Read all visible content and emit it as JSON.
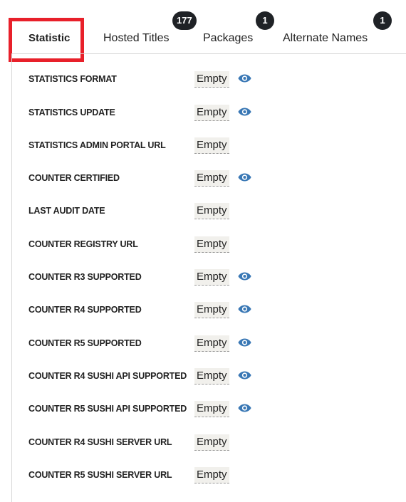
{
  "tabs": [
    {
      "label": "Statistic",
      "active": true,
      "badge": null
    },
    {
      "label": "Hosted Titles",
      "active": false,
      "badge": "177"
    },
    {
      "label": "Packages",
      "active": false,
      "badge": "1"
    },
    {
      "label": "Alternate Names",
      "active": false,
      "badge": "1"
    }
  ],
  "colors": {
    "highlight": "#e8202a",
    "badge_bg": "#1f2226",
    "eye_icon": "#3a78b5",
    "value_bg": "#f1f0ec"
  },
  "fields": [
    {
      "label": "STATISTICS FORMAT",
      "value": "Empty",
      "eye_icon": "eye-icon"
    },
    {
      "label": "STATISTICS UPDATE",
      "value": "Empty",
      "eye_icon": "eye-icon"
    },
    {
      "label": "STATISTICS ADMIN PORTAL URL",
      "value": "Empty",
      "eye_icon": null
    },
    {
      "label": "COUNTER CERTIFIED",
      "value": "Empty",
      "eye_icon": "eye-icon"
    },
    {
      "label": "LAST AUDIT DATE",
      "value": "Empty",
      "eye_icon": null
    },
    {
      "label": "COUNTER REGISTRY URL",
      "value": "Empty",
      "eye_icon": null
    },
    {
      "label": "COUNTER R3 SUPPORTED",
      "value": "Empty",
      "eye_icon": "eye-icon"
    },
    {
      "label": "COUNTER R4 SUPPORTED",
      "value": "Empty",
      "eye_icon": "eye-icon"
    },
    {
      "label": "COUNTER R5 SUPPORTED",
      "value": "Empty",
      "eye_icon": "eye-icon"
    },
    {
      "label": "COUNTER R4 SUSHI API SUPPORTED",
      "value": "Empty",
      "eye_icon": "eye-icon"
    },
    {
      "label": "COUNTER R5 SUSHI API SUPPORTED",
      "value": "Empty",
      "eye_icon": "eye-icon"
    },
    {
      "label": "COUNTER R4 SUSHI SERVER URL",
      "value": "Empty",
      "eye_icon": null
    },
    {
      "label": "COUNTER R5 SUSHI SERVER URL",
      "value": "Empty",
      "eye_icon": null
    }
  ]
}
